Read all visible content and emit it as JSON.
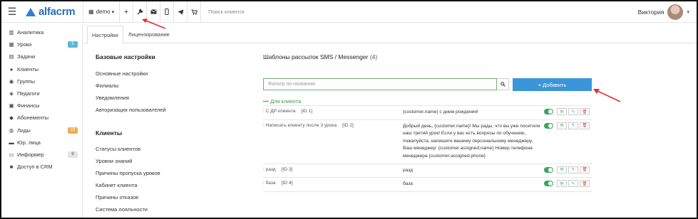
{
  "header": {
    "menu_icon": "hamburger-icon",
    "logo_text": "alfacrm",
    "branch": "demo",
    "branch_caret": "▾",
    "search_placeholder": "Поиск клиента",
    "user_name": "Виктория",
    "icons": [
      "building-icon",
      "plus-icon",
      "wrench-icon",
      "envelope-icon",
      "mobile-icon",
      "telegram-icon",
      "cart-icon"
    ]
  },
  "sidebar": {
    "items": [
      {
        "icon": "chart-icon",
        "glyph": "▥",
        "label": "Аналитика"
      },
      {
        "icon": "calendar-icon",
        "glyph": "▦",
        "label": "Уроки",
        "badge": "5",
        "badge_color": "#5ab8d6"
      },
      {
        "icon": "tasks-icon",
        "glyph": "▤",
        "label": "Задачи"
      },
      {
        "icon": "user-icon",
        "glyph": "●",
        "label": "Клиенты"
      },
      {
        "icon": "group-icon",
        "glyph": "◉",
        "label": "Группы"
      },
      {
        "icon": "teacher-icon",
        "glyph": "◈",
        "label": "Педагоги"
      },
      {
        "icon": "finance-icon",
        "glyph": "▣",
        "label": "Финансы"
      },
      {
        "icon": "tag-icon",
        "glyph": "◆",
        "label": "Абонементы"
      },
      {
        "icon": "leads-icon",
        "glyph": "◍",
        "label": "Лиды",
        "badge": "19",
        "badge_color": "#f0ad4e"
      },
      {
        "icon": "company-icon",
        "glyph": "▬",
        "label": "Юр. лица"
      },
      {
        "icon": "inbox-icon",
        "glyph": "▭",
        "label": "Информер",
        "badge": "9",
        "badge_color": "#e4e4e4"
      },
      {
        "icon": "lock-icon",
        "glyph": "■",
        "label": "Доступ в CRM"
      }
    ]
  },
  "tabs": [
    {
      "label": "Настройки",
      "active": true
    },
    {
      "label": "Лицензирование",
      "active": false
    }
  ],
  "settings_nav": {
    "base_title": "Базовые настройки",
    "base_links": [
      "Основные настройки",
      "Филиалы",
      "Уведомления",
      "Авторизация пользователей"
    ],
    "clients_title": "Клиенты",
    "clients_links": [
      "Статусы клиентов",
      "Уровни знаний",
      "Причины пропуска уроков",
      "Кабинет клиента",
      "Причины отказов",
      "Система лояльности"
    ]
  },
  "content": {
    "title": "Шаблоны рассылок SMS / Messenger",
    "count": "(4)",
    "filter_placeholder": "Фильтр по названию",
    "add_label": "+ Добавить",
    "group_title": "••• Для клиента",
    "templates": [
      {
        "name": "С ДР клиента",
        "id": "[ID 1]",
        "text": "{customer.name} с днем рождения!"
      },
      {
        "name": "Написать клиенту после 3 урока",
        "id": "[ID 2]",
        "text": "Добрый день, {customer.name}! Мы рады, что вы уже посетили наш третий урок! Если у вас есть вопросы по обучению, пожалуйста, напишите вашему персональному менеджеру. Ваш менеджер: {customer.assigned.name} Номер телефона менеджера {customer.assigned.phone}"
      },
      {
        "name": "разд",
        "id": "[ID 3]",
        "text": "разд"
      },
      {
        "name": "база",
        "id": "[ID 4]",
        "text": "база"
      }
    ]
  },
  "colors": {
    "accent": "#3a96d8",
    "toggle_on": "#3aa65a",
    "group_green": "#3a9a52",
    "annotation_red": "#e03030"
  }
}
